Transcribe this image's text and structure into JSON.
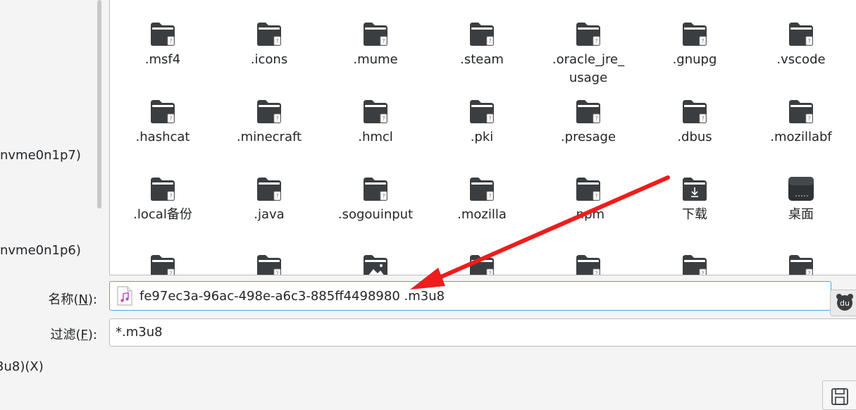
{
  "places": {
    "items": [
      {
        "label": "nvme0n1p7)"
      },
      {
        "label": "nvme0n1p6)"
      }
    ]
  },
  "file_view": {
    "rows": [
      [
        ".msf4",
        ".icons",
        ".mume",
        ".steam",
        ".oracle_jre_\nusage",
        ".gnupg",
        ".vscode"
      ],
      [
        ".hashcat",
        ".minecraft",
        ".hmcl",
        ".pki",
        ".presage",
        ".dbus",
        ".mozillabf"
      ],
      [
        ".local备份",
        ".java",
        ".sogouinput",
        ".mozilla",
        ".npm",
        "下载",
        "桌面"
      ],
      [
        "",
        "",
        "",
        "",
        "",
        "",
        ""
      ]
    ],
    "special_icons": {
      "下载": "download-folder-icon",
      "桌面": "desktop-folder-icon",
      "row4_col3": "pictures-folder-icon"
    }
  },
  "name_row": {
    "label": "名称(",
    "mnemonic": "N",
    "label_end": "):",
    "value": "fe97ec3a-96ac-498e-a6c3-885ff4498980 .m3u8",
    "file_icon": "audio-file-icon"
  },
  "filter_row": {
    "label": "过滤(",
    "mnemonic": "F",
    "label_end": "):",
    "value": "*.m3u8"
  },
  "filetype_row": {
    "label": "3u8)(",
    "mnemonic": "X",
    "label_end": ")"
  },
  "ime": {
    "label": "du"
  },
  "annotation": {
    "color": "#ee1c1c"
  },
  "colors": {
    "accent": "#3daee9",
    "folder": "#3b3e41"
  }
}
